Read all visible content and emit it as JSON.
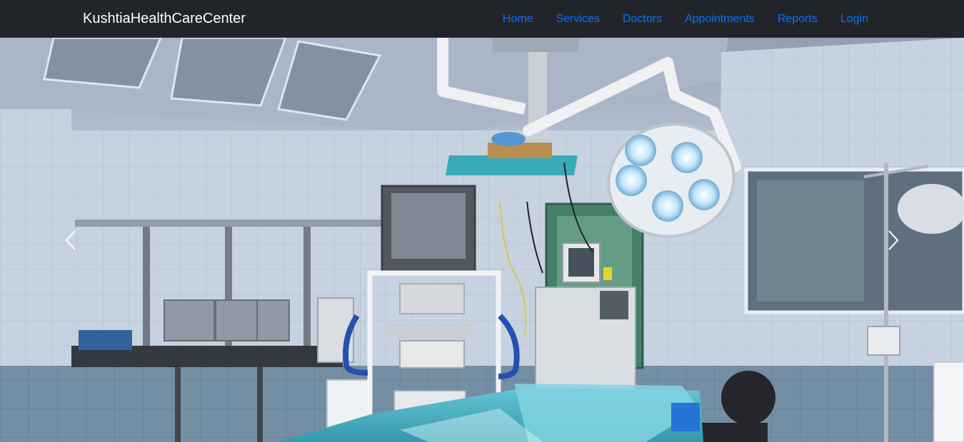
{
  "navbar": {
    "brand": "KushtiaHealthCareCenter",
    "links": [
      {
        "label": "Home"
      },
      {
        "label": "Services"
      },
      {
        "label": "Doctors"
      },
      {
        "label": "Appointments"
      },
      {
        "label": "Reports"
      },
      {
        "label": "Login"
      }
    ],
    "link_color": "#0d6efd",
    "background": "#212529"
  },
  "carousel": {
    "prev_icon": "chevron-left-icon",
    "next_icon": "chevron-right-icon",
    "slide_subject": "operating-room-photo"
  }
}
